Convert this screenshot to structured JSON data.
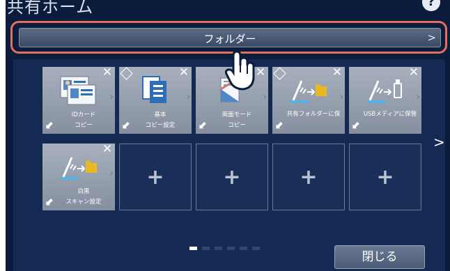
{
  "screen": {
    "title": "共有ホーム",
    "help_icon": "help-icon",
    "accent": "#e3705c"
  },
  "folder_bar": {
    "label": "フォルダー",
    "chevron": ">"
  },
  "tiles": [
    {
      "label": "IDカード\nコピー",
      "icon": "id-card-copy-icon",
      "closable": true,
      "badge": false
    },
    {
      "label": "基本\nコピー設定",
      "icon": "copy-document-icon",
      "closable": true,
      "badge": true
    },
    {
      "label": "両面モード\nコピー",
      "icon": "duplex-copy-icon",
      "closable": true,
      "badge": false
    },
    {
      "label": "共有フォルダーに保",
      "icon": "scan-to-folder-icon",
      "closable": true,
      "badge": true
    },
    {
      "label": "USBメディアに保管",
      "icon": "scan-to-usb-icon",
      "closable": true,
      "badge": false
    },
    {
      "label": "白黒\nスキャン設定",
      "icon": "scan-to-folder-icon",
      "closable": true,
      "badge": false
    }
  ],
  "empty_slot_symbol": "+",
  "next_page_symbol": ">",
  "swipe_symbol": "⬋",
  "pagination": {
    "pages": 6,
    "current": 1
  },
  "close_button": {
    "label": "閉じる"
  }
}
